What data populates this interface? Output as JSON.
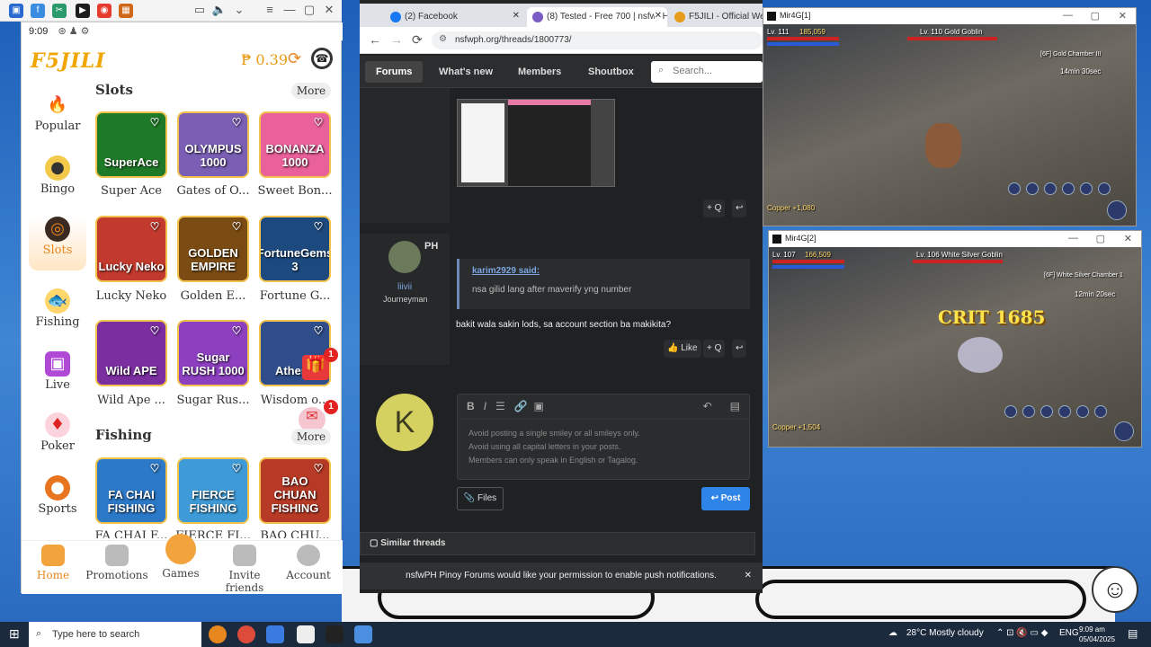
{
  "phone": {
    "status_time": "9:09",
    "logo": "F5JILI",
    "balance": "₱ 0.39",
    "slots_title": "Slots",
    "slots_more": "More",
    "fishing_title": "Fishing",
    "fishing_more": "More",
    "categories": [
      {
        "label": "Popular"
      },
      {
        "label": "Bingo"
      },
      {
        "label": "Slots"
      },
      {
        "label": "Fishing"
      },
      {
        "label": "Live"
      },
      {
        "label": "Poker"
      },
      {
        "label": "Sports"
      }
    ],
    "slot_games": [
      {
        "art": "SuperAce",
        "name": "Super Ace",
        "color": "#1f7a27"
      },
      {
        "art": "OLYMPUS 1000",
        "name": "Gates of O...",
        "color": "#7b5fb5"
      },
      {
        "art": "BONANZA 1000",
        "name": "Sweet Bon...",
        "color": "#e9609a"
      },
      {
        "art": "Lucky Neko",
        "name": "Lucky Neko",
        "color": "#c23a2d"
      },
      {
        "art": "GOLDEN EMPIRE",
        "name": "Golden E...",
        "color": "#7a4b12"
      },
      {
        "art": "FortuneGems 3",
        "name": "Fortune G...",
        "color": "#1c4a7f"
      },
      {
        "art": "Wild APE",
        "name": "Wild Ape ...",
        "color": "#7a2ea0"
      },
      {
        "art": "Sugar RUSH 1000",
        "name": "Sugar Rus...",
        "color": "#8c3fbf"
      },
      {
        "art": "Athena",
        "name": "Wisdom o...",
        "color": "#2e4d8a"
      }
    ],
    "fishing_games": [
      {
        "art": "FA CHAI FISHING",
        "name": "FA CHAI F...",
        "color": "#2c79c8"
      },
      {
        "art": "FIERCE FISHING",
        "name": "FIERCE FI...",
        "color": "#3f9bd8"
      },
      {
        "art": "BAO CHUAN FISHING",
        "name": "BAO CHU...",
        "color": "#b73a26"
      }
    ],
    "badges": [
      "1",
      "1"
    ],
    "nav": [
      {
        "label": "Home"
      },
      {
        "label": "Promotions"
      },
      {
        "label": "Games"
      },
      {
        "label": "Invite friends"
      },
      {
        "label": "Account"
      }
    ]
  },
  "browser": {
    "tabs": [
      {
        "label": "(2) Facebook"
      },
      {
        "label": "(8) Tested - Free 700 | nsfwPH P"
      },
      {
        "label": "F5JILI - Official Website"
      }
    ],
    "url": "nsfwph.org/threads/1800773/",
    "nav": {
      "forums": "Forums",
      "whats_new": "What's new",
      "members": "Members",
      "shoutbox": "Shoutbox",
      "search_placeholder": "Search..."
    },
    "post_actions": {
      "quote": "+ Q",
      "like": "Like"
    },
    "post": {
      "user_short": "PH",
      "username": "liivii",
      "rank": "Journeyman",
      "quote_author": "karim2929 said:",
      "quote_text": "nsa gilid lang after maverify yng number",
      "message": "bakit wala sakin lods, sa account section ba makikita?"
    },
    "reply": {
      "avatar_letter": "K",
      "placeholder_lines": [
        "Avoid posting a single smiley or all smileys only.",
        "Avoid using all capital letters in your posts.",
        "Members can only speak in English or Tagalog."
      ],
      "files": "Files",
      "post": "Post"
    },
    "similar": "Similar threads",
    "notification": "nsfwPH Pinoy Forums would like your permission to enable push notifications."
  },
  "games": [
    {
      "title": "Mir4G[1]",
      "level": "Lv. 111",
      "power": "185,059",
      "target": "Lv. 110 Gold Goblin",
      "location": "[6F] Gold Chamber III",
      "timer": "14min 30sec",
      "copper": "Copper +1,080"
    },
    {
      "title": "Mir4G[2]",
      "level": "Lv. 107",
      "power": "166,509",
      "target": "Lv. 106 White Silver Goblin",
      "location": "[6F] White Silver Chamber 1",
      "timer": "12min 20sec",
      "crit": "CRIT 1685",
      "copper": "Copper +1,504"
    }
  ],
  "taskbar": {
    "search_placeholder": "Type here to search",
    "weather": "28°C  Mostly cloudy",
    "lang": "ENG",
    "time": "9:09 am",
    "date": "05/04/2025"
  },
  "colors": {
    "accent": "#e8871e",
    "post_button": "#2f84e8",
    "desktop": "#2c6fc0"
  }
}
